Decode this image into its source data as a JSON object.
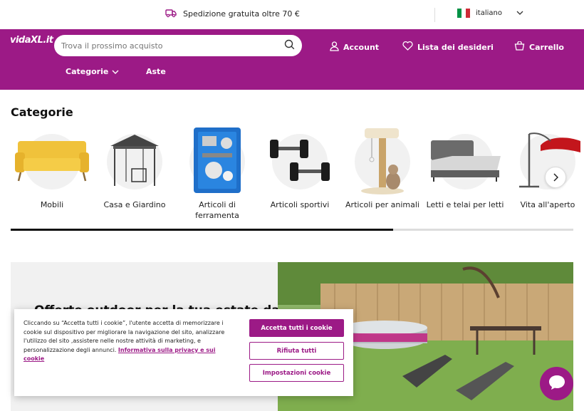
{
  "topbar": {
    "shipping_text": "Spedizione gratuita oltre 70 €",
    "language": "italiano"
  },
  "header": {
    "logo": "vidaXL.it",
    "search_placeholder": "Trova il prossimo acquisto",
    "account": "Account",
    "wishlist": "Lista dei desideri",
    "cart": "Carrello",
    "nav_categories": "Categorie",
    "nav_auctions": "Aste"
  },
  "categories": {
    "title": "Categorie",
    "items": [
      {
        "label": "Mobili"
      },
      {
        "label": "Casa e Giardino"
      },
      {
        "label": "Articoli di ferramenta"
      },
      {
        "label": "Articoli sportivi"
      },
      {
        "label": "Articoli per animali"
      },
      {
        "label": "Letti e telai per letti"
      },
      {
        "label": "Vita all'aperto"
      }
    ],
    "scroll_progress": 0.68
  },
  "banner": {
    "headline": "Offerte outdoor per la tua estate da"
  },
  "cookie": {
    "text": "Cliccando su “Accetta tutti i cookie”, l'utente accetta di memorizzare i cookie sul dispositivo per migliorare la navigazione del sito, analizzare l'utilizzo del sito ,assistere nelle nostre attività di marketing, e personalizzazione degli annunci.",
    "policy_link": "Informativa sulla privacy e sui cookie",
    "accept_all": "Accetta tutti i cookie",
    "reject_all": "Rifiuta tutti",
    "settings": "Impostazioni cookie"
  },
  "colors": {
    "brand": "#9c1a86"
  }
}
